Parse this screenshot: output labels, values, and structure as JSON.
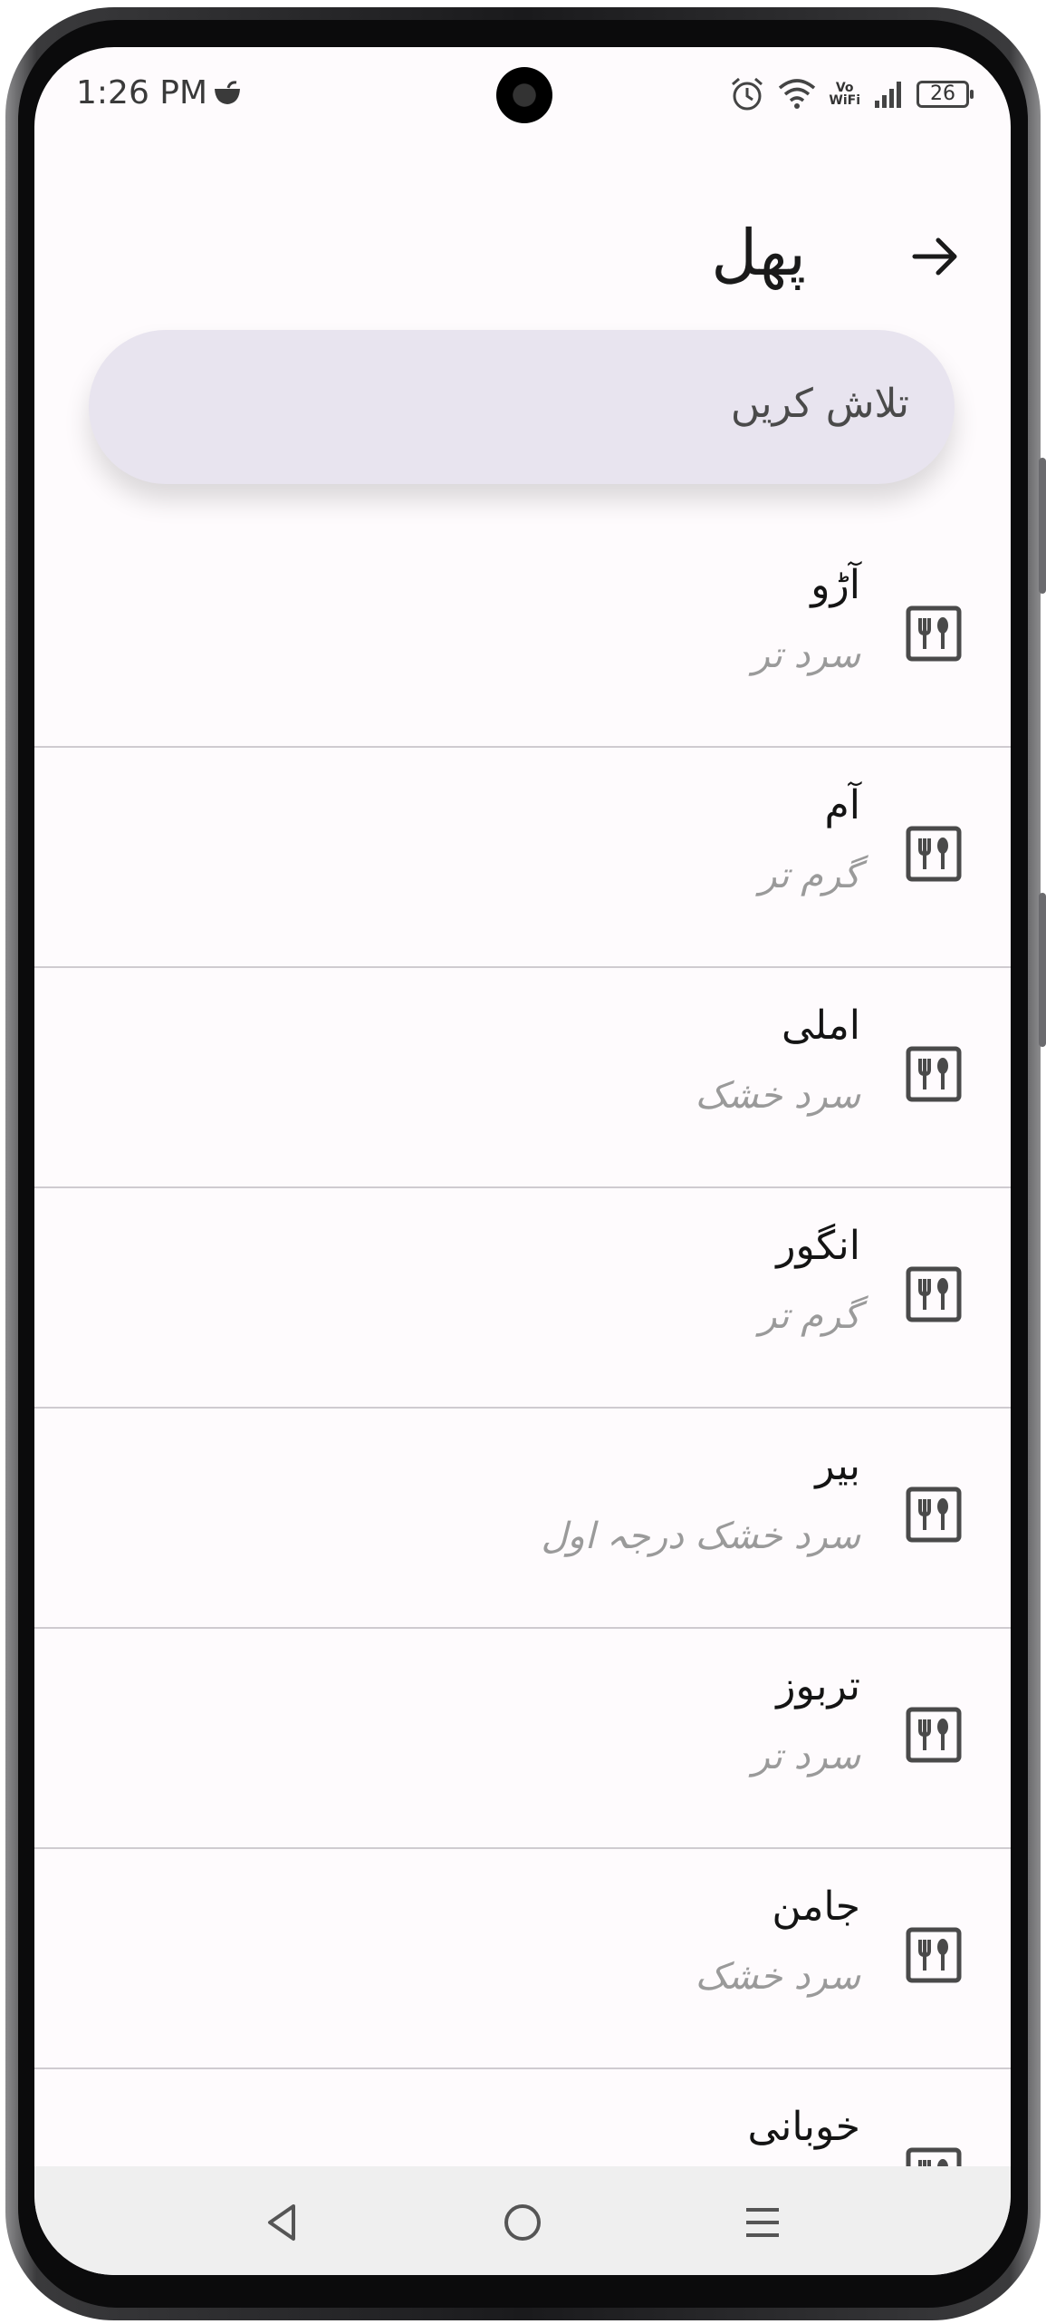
{
  "status_bar": {
    "time": "1:26 PM",
    "vowifi_top": "Vo",
    "vowifi_bottom": "WiFi",
    "battery": "26"
  },
  "header": {
    "title": "پھل"
  },
  "search": {
    "placeholder": "تلاش کریں"
  },
  "items": [
    {
      "title": "آڑو",
      "subtitle": "سرد تر"
    },
    {
      "title": "آم",
      "subtitle": "گرم تر"
    },
    {
      "title": "املی",
      "subtitle": "سرد خشک"
    },
    {
      "title": "انگور",
      "subtitle": "گرم تر"
    },
    {
      "title": "بیر",
      "subtitle": "سرد خشک درجہ اول"
    },
    {
      "title": "تربوز",
      "subtitle": "سرد تر"
    },
    {
      "title": "جامن",
      "subtitle": "سرد خشک"
    },
    {
      "title": "خوبانی",
      "subtitle": ""
    }
  ],
  "icons": {
    "item_icon": "restaurant-icon",
    "back": "arrow-right-icon"
  }
}
